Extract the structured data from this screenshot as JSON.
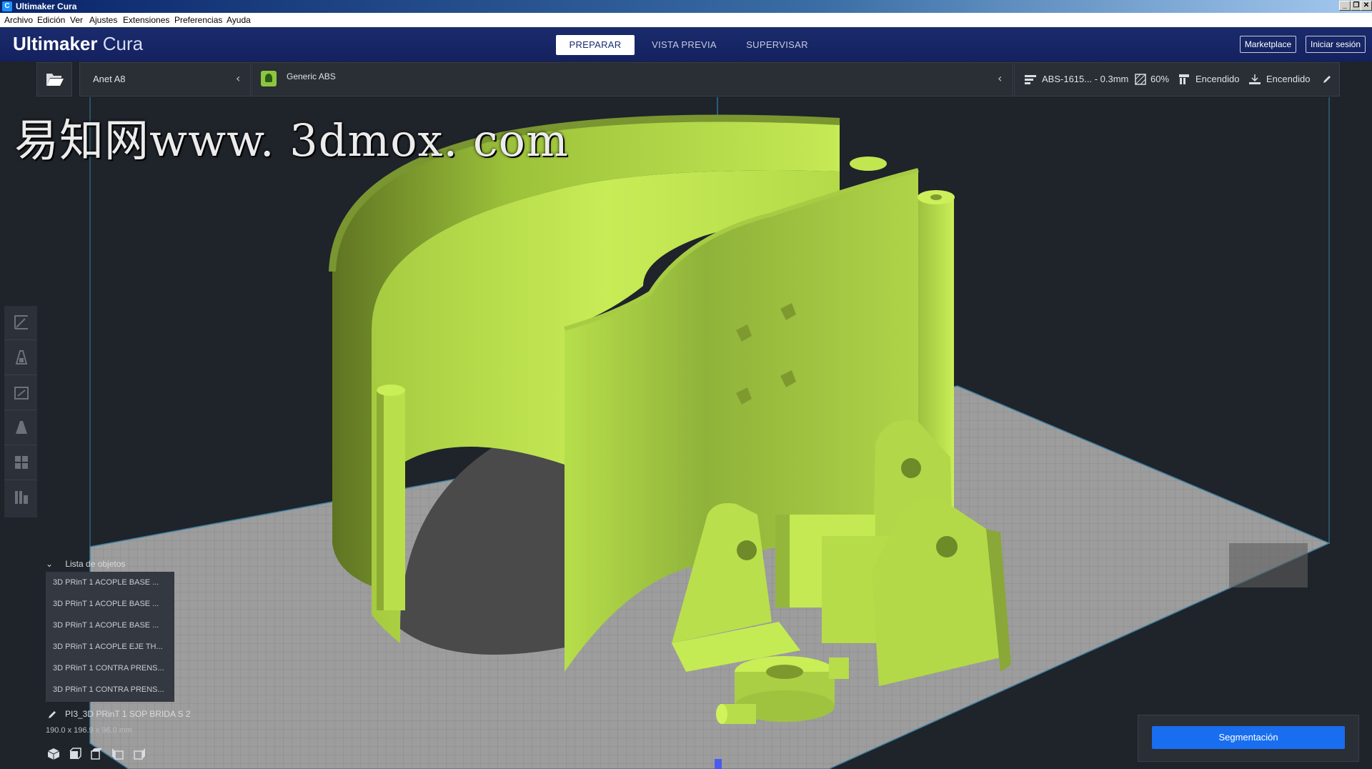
{
  "window": {
    "title": "Ultimaker Cura",
    "controls": [
      "_",
      "❐",
      "✕"
    ]
  },
  "menubar": {
    "items": [
      "Archivo",
      "Edición",
      "Ver",
      "Ajustes",
      "Extensiones",
      "Preferencias",
      "Ayuda"
    ]
  },
  "header": {
    "brand_bold": "Ultimaker",
    "brand_light": "Cura",
    "tabs": [
      {
        "label": "PREPARAR",
        "active": true
      },
      {
        "label": "VISTA PREVIA",
        "active": false
      },
      {
        "label": "SUPERVISAR",
        "active": false
      }
    ],
    "marketplace_label": "Marketplace",
    "signin_label": "Iniciar sesión",
    "color": "#142160"
  },
  "stage": {
    "folder_icon": "folder-open-icon",
    "printer": "Anet A8",
    "material": "Generic ABS",
    "profile": "ABS-1615... - 0.3mm",
    "infill": "60%",
    "support": "Encendido",
    "adhesion": "Encendido"
  },
  "tools": [
    "move-icon",
    "scale-icon",
    "rotate-icon",
    "mirror-icon",
    "per-model-settings-icon",
    "support-blocker-icon"
  ],
  "object_list": {
    "header": "Lista de objetos",
    "items": [
      "3D PRinT 1   ACOPLE BASE ...",
      "3D PRinT 1   ACOPLE BASE ...",
      "3D PRinT 1   ACOPLE BASE ...",
      "3D PRinT 1   ACOPLE EJE TH...",
      "3D PRinT 1   CONTRA PRENS...",
      "3D PRinT 1   CONTRA PRENS..."
    ],
    "selected_name": "PI3_3D PRinT 1   SOP BRIDA S 2",
    "selected_dims": "190.0 x 196.9 x 96.0 mm"
  },
  "view_buttons": [
    "3d-view-icon",
    "front-view-icon",
    "top-view-icon",
    "left-view-icon",
    "right-view-icon"
  ],
  "slice": {
    "label": "Segmentación",
    "color": "#196ef0"
  },
  "watermark": "易知网www. 3dmox. com",
  "colors": {
    "model": "#b8e04a",
    "build_plate": "#9a9a9a",
    "background": "#1f232a"
  }
}
